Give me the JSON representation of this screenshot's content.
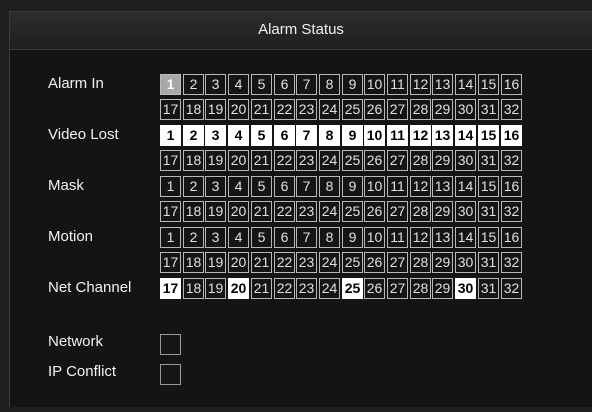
{
  "title": "Alarm Status",
  "rows": [
    {
      "label": "Alarm In",
      "cells": [
        {
          "n": "1",
          "state": "gray"
        },
        {
          "n": "2",
          "state": "normal"
        },
        {
          "n": "3",
          "state": "normal"
        },
        {
          "n": "4",
          "state": "normal"
        },
        {
          "n": "5",
          "state": "normal"
        },
        {
          "n": "6",
          "state": "normal"
        },
        {
          "n": "7",
          "state": "normal"
        },
        {
          "n": "8",
          "state": "normal"
        },
        {
          "n": "9",
          "state": "normal"
        },
        {
          "n": "10",
          "state": "normal"
        },
        {
          "n": "11",
          "state": "normal"
        },
        {
          "n": "12",
          "state": "normal"
        },
        {
          "n": "13",
          "state": "normal"
        },
        {
          "n": "14",
          "state": "normal"
        },
        {
          "n": "15",
          "state": "normal"
        },
        {
          "n": "16",
          "state": "normal"
        },
        {
          "n": "17",
          "state": "normal"
        },
        {
          "n": "18",
          "state": "normal"
        },
        {
          "n": "19",
          "state": "normal"
        },
        {
          "n": "20",
          "state": "normal"
        },
        {
          "n": "21",
          "state": "normal"
        },
        {
          "n": "22",
          "state": "normal"
        },
        {
          "n": "23",
          "state": "normal"
        },
        {
          "n": "24",
          "state": "normal"
        },
        {
          "n": "25",
          "state": "normal"
        },
        {
          "n": "26",
          "state": "normal"
        },
        {
          "n": "27",
          "state": "normal"
        },
        {
          "n": "28",
          "state": "normal"
        },
        {
          "n": "29",
          "state": "normal"
        },
        {
          "n": "30",
          "state": "normal"
        },
        {
          "n": "31",
          "state": "normal"
        },
        {
          "n": "32",
          "state": "normal"
        }
      ]
    },
    {
      "label": "Video Lost",
      "cells": [
        {
          "n": "1",
          "state": "white"
        },
        {
          "n": "2",
          "state": "white"
        },
        {
          "n": "3",
          "state": "white"
        },
        {
          "n": "4",
          "state": "white"
        },
        {
          "n": "5",
          "state": "white"
        },
        {
          "n": "6",
          "state": "white"
        },
        {
          "n": "7",
          "state": "white"
        },
        {
          "n": "8",
          "state": "white"
        },
        {
          "n": "9",
          "state": "white"
        },
        {
          "n": "10",
          "state": "white"
        },
        {
          "n": "11",
          "state": "white"
        },
        {
          "n": "12",
          "state": "white"
        },
        {
          "n": "13",
          "state": "white"
        },
        {
          "n": "14",
          "state": "white"
        },
        {
          "n": "15",
          "state": "white"
        },
        {
          "n": "16",
          "state": "white"
        },
        {
          "n": "17",
          "state": "normal"
        },
        {
          "n": "18",
          "state": "normal"
        },
        {
          "n": "19",
          "state": "normal"
        },
        {
          "n": "20",
          "state": "normal"
        },
        {
          "n": "21",
          "state": "normal"
        },
        {
          "n": "22",
          "state": "normal"
        },
        {
          "n": "23",
          "state": "normal"
        },
        {
          "n": "24",
          "state": "normal"
        },
        {
          "n": "25",
          "state": "normal"
        },
        {
          "n": "26",
          "state": "normal"
        },
        {
          "n": "27",
          "state": "normal"
        },
        {
          "n": "28",
          "state": "normal"
        },
        {
          "n": "29",
          "state": "normal"
        },
        {
          "n": "30",
          "state": "normal"
        },
        {
          "n": "31",
          "state": "normal"
        },
        {
          "n": "32",
          "state": "normal"
        }
      ]
    },
    {
      "label": "Mask",
      "cells": [
        {
          "n": "1",
          "state": "normal"
        },
        {
          "n": "2",
          "state": "normal"
        },
        {
          "n": "3",
          "state": "normal"
        },
        {
          "n": "4",
          "state": "normal"
        },
        {
          "n": "5",
          "state": "normal"
        },
        {
          "n": "6",
          "state": "normal"
        },
        {
          "n": "7",
          "state": "normal"
        },
        {
          "n": "8",
          "state": "normal"
        },
        {
          "n": "9",
          "state": "normal"
        },
        {
          "n": "10",
          "state": "normal"
        },
        {
          "n": "11",
          "state": "normal"
        },
        {
          "n": "12",
          "state": "normal"
        },
        {
          "n": "13",
          "state": "normal"
        },
        {
          "n": "14",
          "state": "normal"
        },
        {
          "n": "15",
          "state": "normal"
        },
        {
          "n": "16",
          "state": "normal"
        },
        {
          "n": "17",
          "state": "normal"
        },
        {
          "n": "18",
          "state": "normal"
        },
        {
          "n": "19",
          "state": "normal"
        },
        {
          "n": "20",
          "state": "normal"
        },
        {
          "n": "21",
          "state": "normal"
        },
        {
          "n": "22",
          "state": "normal"
        },
        {
          "n": "23",
          "state": "normal"
        },
        {
          "n": "24",
          "state": "normal"
        },
        {
          "n": "25",
          "state": "normal"
        },
        {
          "n": "26",
          "state": "normal"
        },
        {
          "n": "27",
          "state": "normal"
        },
        {
          "n": "28",
          "state": "normal"
        },
        {
          "n": "29",
          "state": "normal"
        },
        {
          "n": "30",
          "state": "normal"
        },
        {
          "n": "31",
          "state": "normal"
        },
        {
          "n": "32",
          "state": "normal"
        }
      ]
    },
    {
      "label": "Motion",
      "cells": [
        {
          "n": "1",
          "state": "normal"
        },
        {
          "n": "2",
          "state": "normal"
        },
        {
          "n": "3",
          "state": "normal"
        },
        {
          "n": "4",
          "state": "normal"
        },
        {
          "n": "5",
          "state": "normal"
        },
        {
          "n": "6",
          "state": "normal"
        },
        {
          "n": "7",
          "state": "normal"
        },
        {
          "n": "8",
          "state": "normal"
        },
        {
          "n": "9",
          "state": "normal"
        },
        {
          "n": "10",
          "state": "normal"
        },
        {
          "n": "11",
          "state": "normal"
        },
        {
          "n": "12",
          "state": "normal"
        },
        {
          "n": "13",
          "state": "normal"
        },
        {
          "n": "14",
          "state": "normal"
        },
        {
          "n": "15",
          "state": "normal"
        },
        {
          "n": "16",
          "state": "normal"
        },
        {
          "n": "17",
          "state": "normal"
        },
        {
          "n": "18",
          "state": "normal"
        },
        {
          "n": "19",
          "state": "normal"
        },
        {
          "n": "20",
          "state": "normal"
        },
        {
          "n": "21",
          "state": "normal"
        },
        {
          "n": "22",
          "state": "normal"
        },
        {
          "n": "23",
          "state": "normal"
        },
        {
          "n": "24",
          "state": "normal"
        },
        {
          "n": "25",
          "state": "normal"
        },
        {
          "n": "26",
          "state": "normal"
        },
        {
          "n": "27",
          "state": "normal"
        },
        {
          "n": "28",
          "state": "normal"
        },
        {
          "n": "29",
          "state": "normal"
        },
        {
          "n": "30",
          "state": "normal"
        },
        {
          "n": "31",
          "state": "normal"
        },
        {
          "n": "32",
          "state": "normal"
        }
      ]
    },
    {
      "label": "Net Channel",
      "cells": [
        {
          "n": "17",
          "state": "white"
        },
        {
          "n": "18",
          "state": "normal"
        },
        {
          "n": "19",
          "state": "normal"
        },
        {
          "n": "20",
          "state": "white"
        },
        {
          "n": "21",
          "state": "normal"
        },
        {
          "n": "22",
          "state": "normal"
        },
        {
          "n": "23",
          "state": "normal"
        },
        {
          "n": "24",
          "state": "normal"
        },
        {
          "n": "25",
          "state": "white"
        },
        {
          "n": "26",
          "state": "normal"
        },
        {
          "n": "27",
          "state": "normal"
        },
        {
          "n": "28",
          "state": "normal"
        },
        {
          "n": "29",
          "state": "normal"
        },
        {
          "n": "30",
          "state": "white"
        },
        {
          "n": "31",
          "state": "normal"
        },
        {
          "n": "32",
          "state": "normal"
        }
      ]
    }
  ],
  "checks": [
    {
      "label": "Network",
      "checked": false
    },
    {
      "label": "IP Conflict",
      "checked": false
    }
  ],
  "colors": {
    "active": "#ffffff",
    "alarm_in_active": "#a8a8a8",
    "background": "#141414"
  }
}
